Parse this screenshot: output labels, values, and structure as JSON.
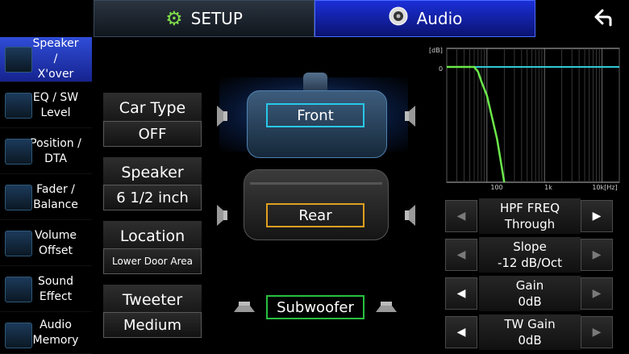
{
  "header": {
    "tabs": [
      {
        "label": "SETUP",
        "icon": "gear-icon"
      },
      {
        "label": "Audio",
        "icon": "speaker-icon"
      }
    ],
    "back_icon": "back-arrow-icon"
  },
  "sidebar": {
    "items": [
      {
        "line1": "Speaker /",
        "line2": "X'over",
        "active": true
      },
      {
        "line1": "EQ / SW",
        "line2": "Level"
      },
      {
        "line1": "Position /",
        "line2": "DTA"
      },
      {
        "line1": "Fader /",
        "line2": "Balance"
      },
      {
        "line1": "Volume",
        "line2": "Offset"
      },
      {
        "line1": "Sound",
        "line2": "Effect"
      },
      {
        "line1": "Audio",
        "line2": "Memory"
      }
    ]
  },
  "settings": {
    "car_type": {
      "label": "Car Type",
      "value": "OFF"
    },
    "speaker": {
      "label": "Speaker",
      "value": "6 1/2 inch"
    },
    "location": {
      "label": "Location",
      "value": "Lower Door Area"
    },
    "tweeter": {
      "label": "Tweeter",
      "value": "Medium"
    }
  },
  "zones": {
    "front": "Front",
    "rear": "Rear",
    "subwoofer": "Subwoofer"
  },
  "chart_data": {
    "type": "line",
    "title": "",
    "ylabel": "[dB]",
    "xlabel": "",
    "y_ticks": [
      "0"
    ],
    "x_ticks": [
      "100",
      "1k",
      "10k[Hz]"
    ],
    "xscale": "log",
    "grid": true,
    "series": [
      {
        "x": [
          20,
          40,
          60,
          70,
          80,
          100,
          150,
          200
        ],
        "y": [
          0,
          0,
          0,
          -1,
          -3,
          -6,
          -15,
          -24
        ],
        "color": "#6be84a"
      }
    ],
    "reference_line": {
      "y": 0,
      "color": "#32c8d8"
    }
  },
  "params": [
    {
      "label": "HPF FREQ",
      "value": "Through",
      "left_enabled": false,
      "right_enabled": true
    },
    {
      "label": "Slope",
      "value": "-12 dB/Oct",
      "left_enabled": false,
      "right_enabled": false
    },
    {
      "label": "Gain",
      "value": "0dB",
      "left_enabled": true,
      "right_enabled": false
    },
    {
      "label": "TW Gain",
      "value": "0dB",
      "left_enabled": true,
      "right_enabled": false
    }
  ],
  "arrows": {
    "left": "◀",
    "right": "▶"
  }
}
